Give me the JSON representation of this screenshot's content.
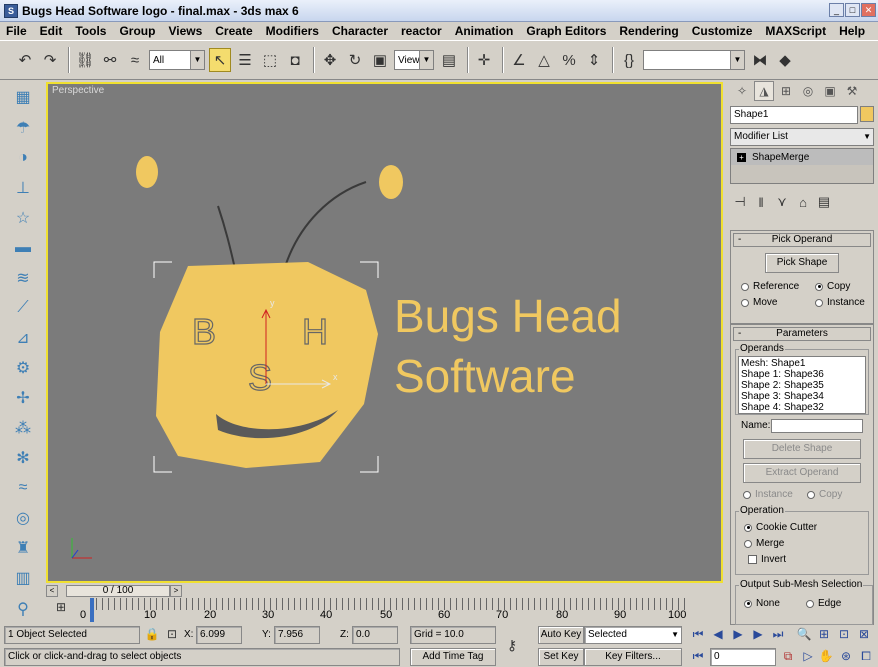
{
  "titlebar": {
    "title": "Bugs Head Software logo - final.max - 3ds max 6",
    "app_icon": "3ds-max-icon"
  },
  "menubar": {
    "items": [
      "File",
      "Edit",
      "Tools",
      "Group",
      "Views",
      "Create",
      "Modifiers",
      "Character",
      "reactor",
      "Animation",
      "Graph Editors",
      "Rendering",
      "Customize",
      "MAXScript",
      "Help"
    ]
  },
  "toolbar": {
    "selection_filter": "All",
    "reference_coord": "View"
  },
  "viewport": {
    "label": "Perspective",
    "logo_text_line1": "Bugs Head",
    "logo_text_line2": "Software",
    "letter_b": "B",
    "letter_h": "H",
    "letter_s": "S",
    "axis_x": "x",
    "axis_y": "y",
    "colors": {
      "accent": "#f0c860",
      "viewport_bg": "#7b7b7b",
      "border": "#f0e030"
    }
  },
  "command_panel": {
    "object_name": "Shape1",
    "modifier_list": "Modifier List",
    "stack_item": "ShapeMerge",
    "pick_operand": {
      "title": "Pick Operand",
      "pick_shape_label": "Pick Shape",
      "options": [
        "Reference",
        "Copy",
        "Move",
        "Instance"
      ],
      "selected": "Copy"
    },
    "parameters": {
      "title": "Parameters",
      "operands_label": "Operands",
      "operands": [
        "Mesh: Shape1",
        "Shape 1: Shape36",
        "Shape 2: Shape35",
        "Shape 3: Shape34",
        "Shape 4: Shape32"
      ],
      "name_label": "Name:",
      "delete_shape_label": "Delete Shape",
      "extract_operand_label": "Extract Operand",
      "extract_options": [
        "Instance",
        "Copy"
      ],
      "operation_label": "Operation",
      "operation_options": [
        "Cookie Cutter",
        "Merge"
      ],
      "operation_selected": "Cookie Cutter",
      "invert_label": "Invert",
      "output_label": "Output Sub-Mesh Selection",
      "output_options": [
        "None",
        "Edge"
      ],
      "output_selected": "None"
    }
  },
  "timeslider": {
    "frame_label": "0 / 100"
  },
  "trackbar": {
    "ticks": [
      "0",
      "10",
      "20",
      "30",
      "40",
      "50",
      "60",
      "70",
      "80",
      "90",
      "100"
    ]
  },
  "status": {
    "selection_count": "1 Object Selected",
    "prompt": "Click or click-and-drag to select objects",
    "x_label": "X:",
    "x_value": "6.099",
    "y_label": "Y:",
    "y_value": "7.956",
    "z_label": "Z:",
    "z_value": "0.0",
    "grid": "Grid = 10.0",
    "add_time_tag": "Add Time Tag",
    "auto_key": "Auto Key",
    "set_key": "Set Key",
    "key_mode": "Selected",
    "key_filters": "Key Filters...",
    "current_frame": "0"
  }
}
